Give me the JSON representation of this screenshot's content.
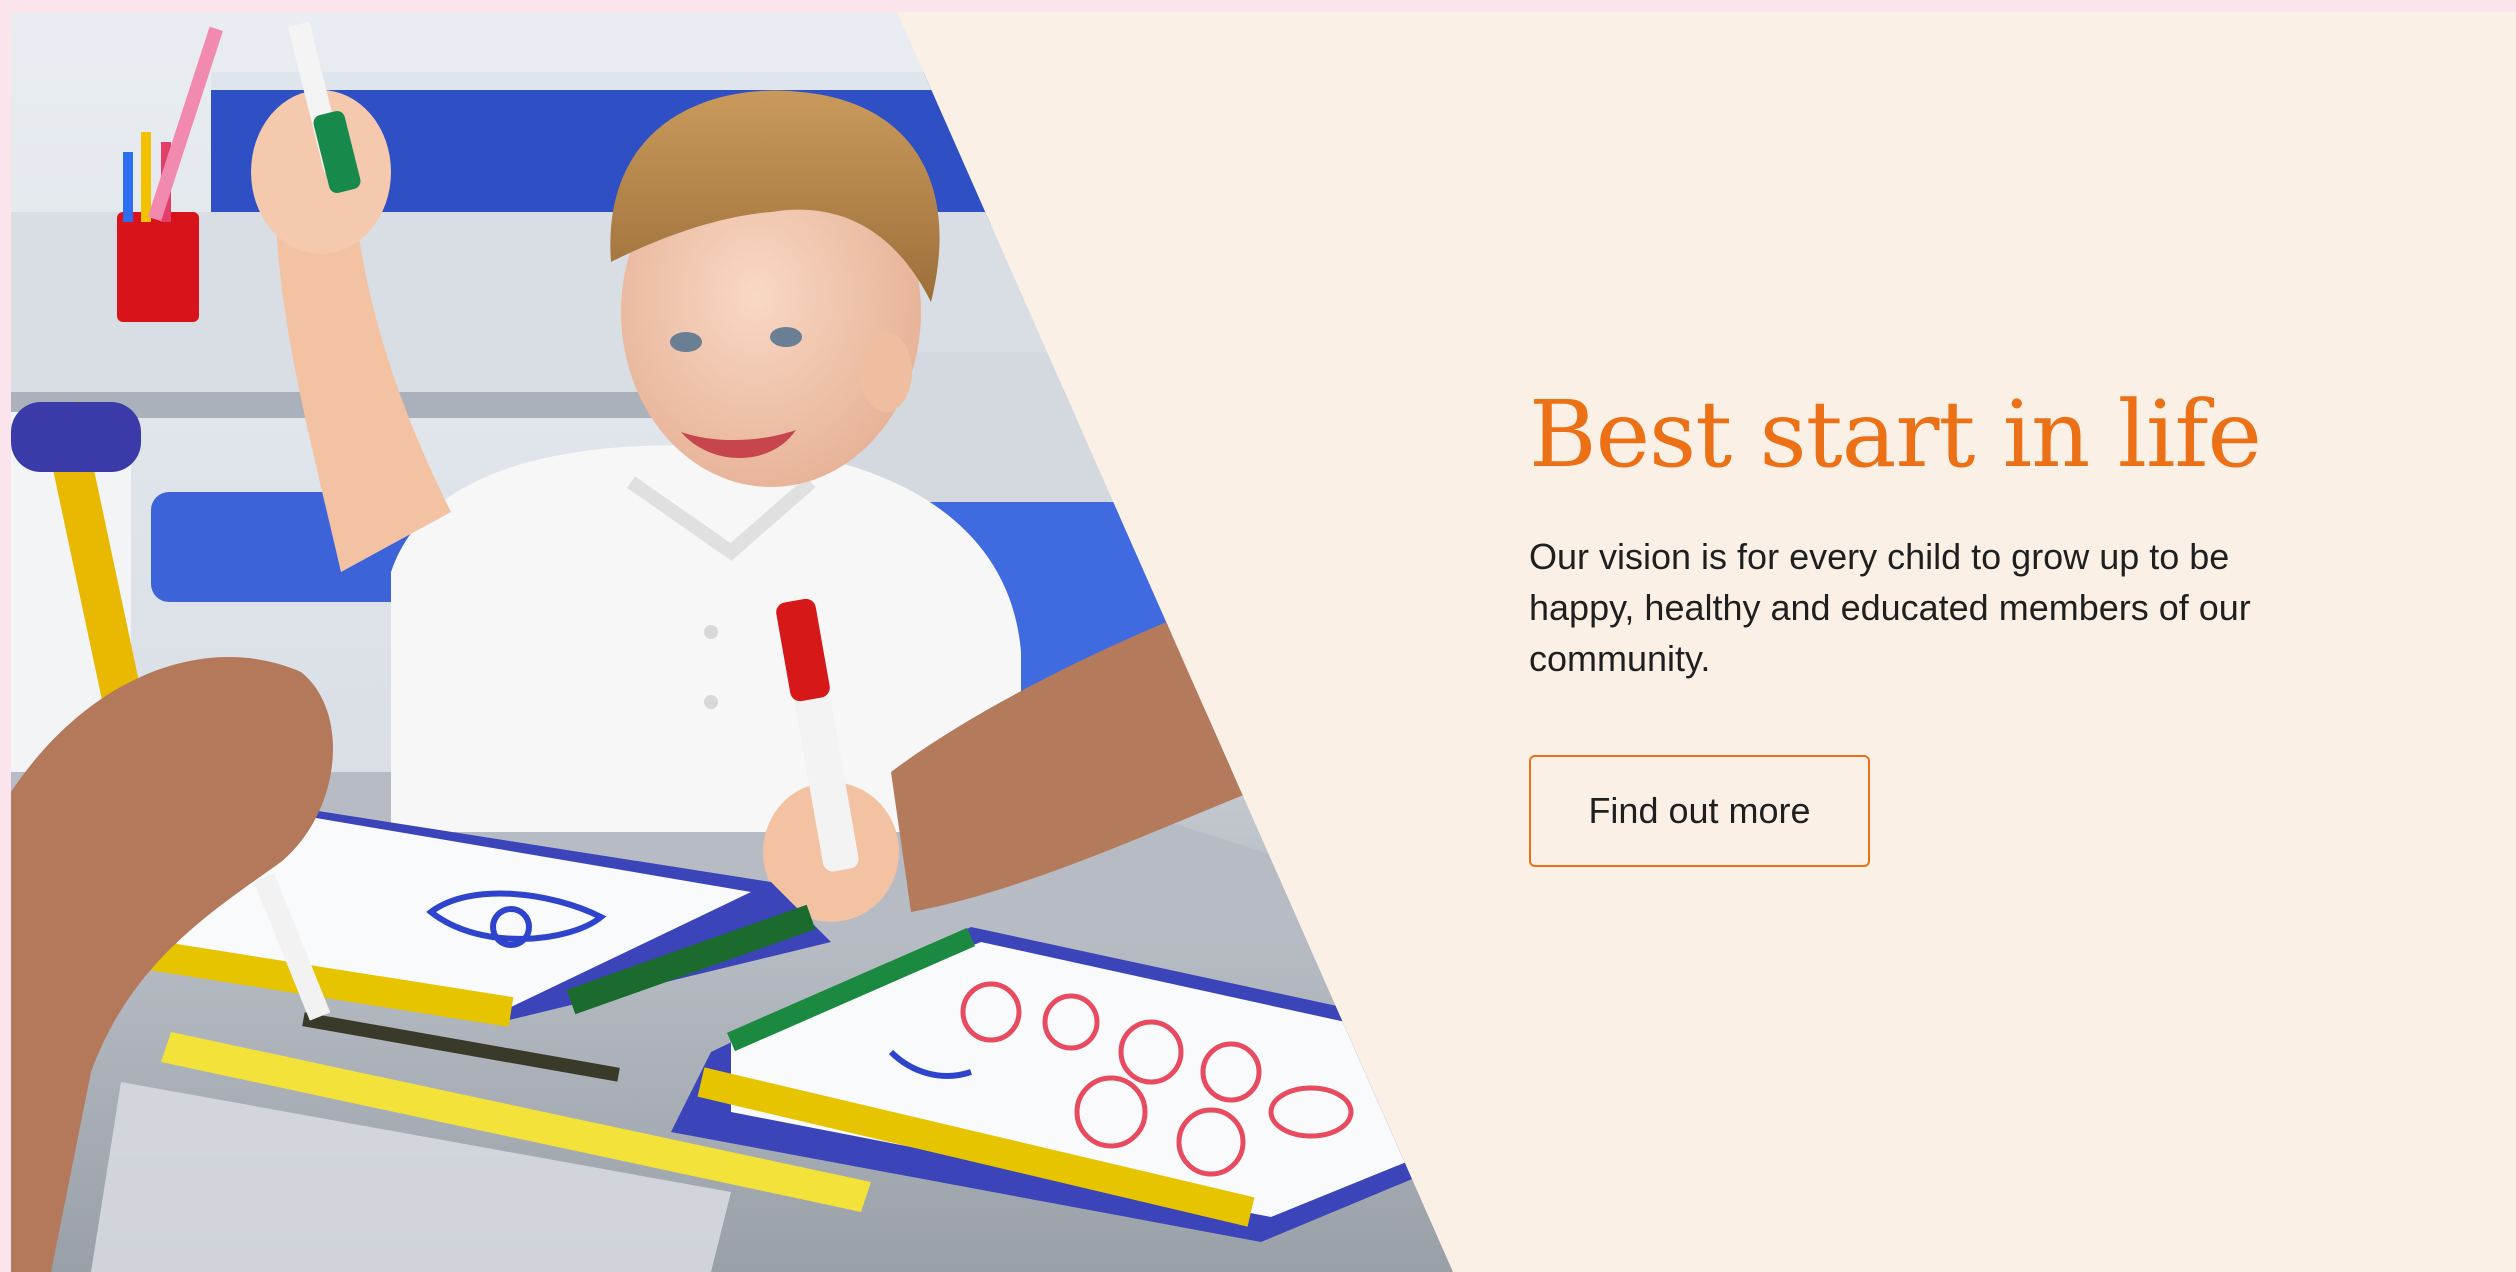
{
  "hero": {
    "title": "Best start in life",
    "description": "Our vision is for every child to grow up to be happy, healthy and educated members of our community.",
    "cta_label": "Find out more",
    "photo_description": "child in classroom drawing on whiteboard"
  },
  "colors": {
    "accent": "#ec7116",
    "panel_background": "#fbf0e6",
    "page_background": "#fce4ec",
    "text": "#1f1f1f"
  }
}
